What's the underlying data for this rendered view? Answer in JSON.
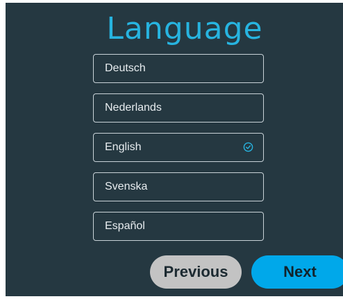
{
  "screen": {
    "title": "Language"
  },
  "languages": [
    {
      "label": "Deutsch",
      "selected": false
    },
    {
      "label": "Nederlands",
      "selected": false
    },
    {
      "label": "English",
      "selected": true
    },
    {
      "label": "Svenska",
      "selected": false
    },
    {
      "label": "Español",
      "selected": false
    }
  ],
  "buttons": {
    "previous_label": "Previous",
    "next_label": "Next"
  },
  "colors": {
    "background": "#253841",
    "accent": "#27b4e0",
    "next_button": "#00a8ea",
    "previous_button": "#c3c3c3",
    "option_border": "#c9d3d8"
  },
  "icons": {
    "selected_indicator": "check-circle-icon"
  }
}
